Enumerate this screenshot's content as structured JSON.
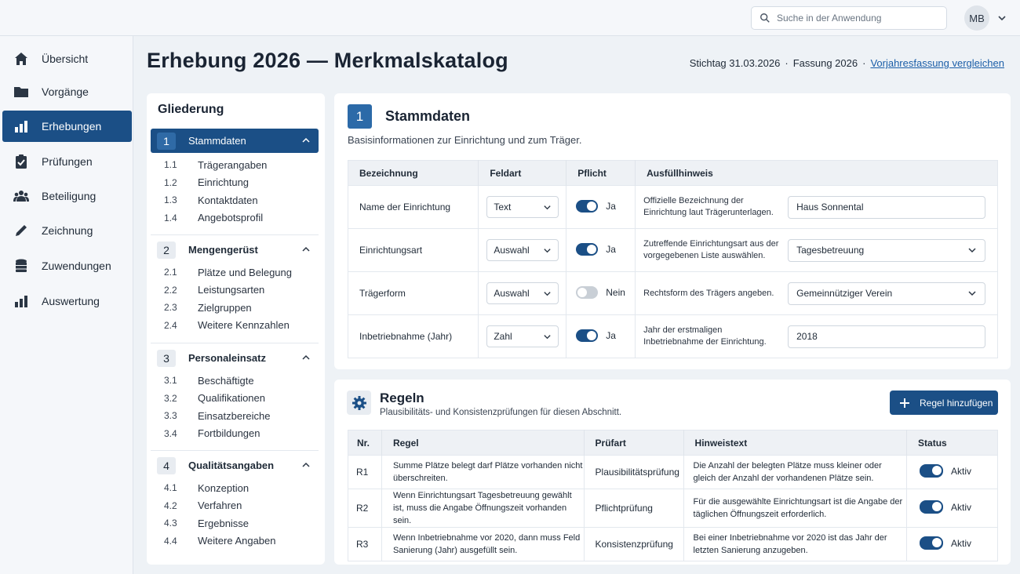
{
  "topbar": {
    "search_placeholder": "Suche in der Anwendung",
    "avatar": "MB"
  },
  "sidebar": {
    "items": [
      {
        "label": "Übersicht",
        "icon": "home-icon"
      },
      {
        "label": "Vorgänge",
        "icon": "folder-icon"
      },
      {
        "label": "Erhebungen",
        "icon": "bar-chart-icon"
      },
      {
        "label": "Prüfungen",
        "icon": "clipboard-check-icon"
      },
      {
        "label": "Beteiligung",
        "icon": "people-icon"
      },
      {
        "label": "Zeichnung",
        "icon": "pen-icon"
      },
      {
        "label": "Zuwendungen",
        "icon": "coins-icon"
      },
      {
        "label": "Auswertung",
        "icon": "bar-chart-icon"
      }
    ],
    "active_index": 2
  },
  "header": {
    "title": "Erhebung 2026 — Merkmalskatalog",
    "stichtag": "Stichtag 31.03.2026",
    "sep": "·",
    "fassung": "Fassung 2026",
    "compare_link": "Vorjahresfassung vergleichen"
  },
  "outline": {
    "title": "Gliederung",
    "groups": [
      {
        "num": "1",
        "title": "Stammdaten",
        "subs": [
          {
            "num": "1.1",
            "label": "Trägerangaben"
          },
          {
            "num": "1.2",
            "label": "Einrichtung"
          },
          {
            "num": "1.3",
            "label": "Kontaktdaten"
          },
          {
            "num": "1.4",
            "label": "Angebotsprofil"
          }
        ]
      },
      {
        "num": "2",
        "title": "Mengengerüst",
        "subs": [
          {
            "num": "2.1",
            "label": "Plätze und Belegung"
          },
          {
            "num": "2.2",
            "label": "Leistungsarten"
          },
          {
            "num": "2.3",
            "label": "Zielgruppen"
          },
          {
            "num": "2.4",
            "label": "Weitere Kennzahlen"
          }
        ]
      },
      {
        "num": "3",
        "title": "Personaleinsatz",
        "subs": [
          {
            "num": "3.1",
            "label": "Beschäftigte"
          },
          {
            "num": "3.2",
            "label": "Qualifikationen"
          },
          {
            "num": "3.3",
            "label": "Einsatzbereiche"
          },
          {
            "num": "3.4",
            "label": "Fortbildungen"
          }
        ]
      },
      {
        "num": "4",
        "title": "Qualitätsangaben",
        "subs": [
          {
            "num": "4.1",
            "label": "Konzeption"
          },
          {
            "num": "4.2",
            "label": "Verfahren"
          },
          {
            "num": "4.3",
            "label": "Ergebnisse"
          },
          {
            "num": "4.4",
            "label": "Weitere Angaben"
          }
        ]
      }
    ]
  },
  "section": {
    "num": "1",
    "title": "Stammdaten",
    "subtitle": "Basisinformationen zur Einrichtung und zum Träger.",
    "columns": [
      "Bezeichnung",
      "Feldart",
      "Pflicht",
      "Ausfüllhinweis"
    ],
    "rows": [
      {
        "name": "Name der Einrichtung",
        "type": "Text",
        "required": true,
        "required_label": "Ja",
        "hint": "Offizielle Bezeichnung der Einrichtung laut Trägerunterlagen.",
        "value": "Haus Sonnental",
        "dropdown": false
      },
      {
        "name": "Einrichtungsart",
        "type": "Auswahl",
        "required": true,
        "required_label": "Ja",
        "hint": "Zutreffende Einrichtungsart aus der vorgegebenen Liste auswählen.",
        "value": "Tagesbetreuung",
        "dropdown": true
      },
      {
        "name": "Trägerform",
        "type": "Auswahl",
        "required": false,
        "required_label": "Nein",
        "hint": "Rechtsform des Trägers angeben.",
        "value": "Gemeinnütziger Verein",
        "dropdown": true
      },
      {
        "name": "Inbetriebnahme (Jahr)",
        "type": "Zahl",
        "required": true,
        "required_label": "Ja",
        "hint": "Jahr der erstmaligen Inbetriebnahme der Einrichtung.",
        "value": "2018",
        "dropdown": false
      }
    ]
  },
  "rules": {
    "title": "Regeln",
    "subtitle": "Plausibilitäts- und Konsistenzprüfungen für diesen Abschnitt.",
    "add_label": "Regel hinzufügen",
    "columns": [
      "Nr.",
      "Regel",
      "Prüfart",
      "Hinweistext",
      "Status"
    ],
    "rows": [
      {
        "nr": "R1",
        "rule": "Summe Plätze belegt darf Plätze vorhanden nicht überschreiten.",
        "kind": "Plausibilitätsprüfung",
        "hint": "Die Anzahl der belegten Plätze muss kleiner oder gleich der Anzahl der vorhandenen Plätze sein.",
        "status": "Aktiv"
      },
      {
        "nr": "R2",
        "rule": "Wenn Einrichtungsart Tagesbetreuung gewählt ist, muss die Angabe Öffnungszeit vorhanden sein.",
        "kind": "Pflichtprüfung",
        "hint": "Für die ausgewählte Einrichtungsart ist die Angabe der täglichen Öffnungszeit erforderlich.",
        "status": "Aktiv"
      },
      {
        "nr": "R3",
        "rule": "Wenn Inbetriebnahme vor 2020, dann muss Feld Sanierung (Jahr) ausgefüllt sein.",
        "kind": "Konsistenzprüfung",
        "hint": "Bei einer Inbetriebnahme vor 2020 ist das Jahr der letzten Sanierung anzugeben.",
        "status": "Aktiv"
      }
    ]
  },
  "colors": {
    "primary": "#1b4f86",
    "accent": "#2c6aa8",
    "background": "#eef2f6"
  }
}
